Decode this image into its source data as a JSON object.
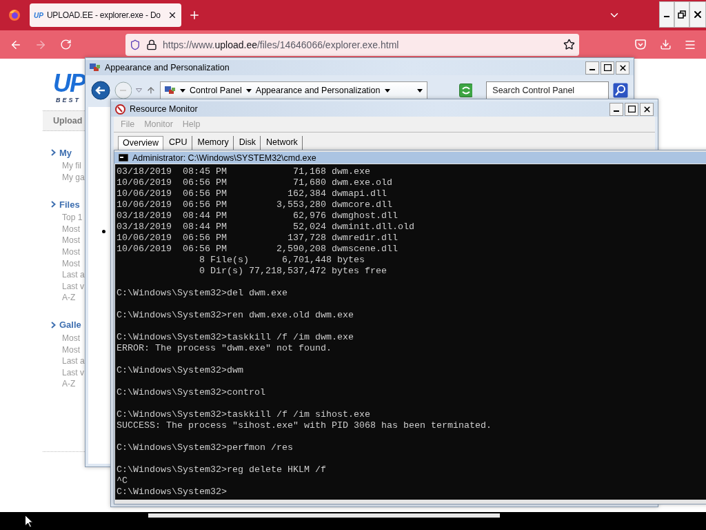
{
  "browser": {
    "tabs": [
      {
        "favicon": "UP",
        "title": "UPLOAD.EE - explorer.exe - Do",
        "selected": true
      }
    ],
    "address": {
      "prefix": "https://www.",
      "domain": "upload.ee",
      "path": "/files/14646066/explorer.exe.html"
    }
  },
  "webpage": {
    "logo": "UP",
    "tagline": "BEST",
    "nav": [
      "Upload"
    ],
    "sections": [
      {
        "title": "My",
        "items": [
          "My fil",
          "My ga"
        ]
      },
      {
        "title": "Files",
        "items": [
          "Top 1",
          "Most",
          "Most",
          "Most",
          "Most",
          "Last a",
          "Last v",
          "A-Z"
        ]
      },
      {
        "title": "Galle",
        "items": [
          "Most",
          "Most",
          "Last a",
          "Last v",
          "A-Z"
        ]
      }
    ]
  },
  "appearance_window": {
    "title": "Appearance and Personalization",
    "breadcrumb": [
      "Control Panel",
      "Appearance and Personalization"
    ],
    "search": {
      "placeholder": "Search Control Panel"
    }
  },
  "resource_monitor": {
    "title": "Resource Monitor",
    "menu": [
      {
        "label": "File",
        "disabled": true
      },
      {
        "label": "Monitor",
        "disabled": true
      },
      {
        "label": "Help",
        "disabled": true
      }
    ],
    "tabs": [
      {
        "label": "Overview",
        "selected": true
      },
      {
        "label": "CPU",
        "selected": false
      },
      {
        "label": "Memory",
        "selected": false
      },
      {
        "label": "Disk",
        "selected": false
      },
      {
        "label": "Network",
        "selected": false
      }
    ]
  },
  "cmd_window": {
    "title": "Administrator: C:\\Windows\\SYSTEM32\\cmd.exe",
    "blocks": [
      [
        "03/18/2019  08:45 PM            71,168 dwm.exe",
        "10/06/2019  06:56 PM            71,680 dwm.exe.old",
        "10/06/2019  06:56 PM           162,384 dwmapi.dll",
        "10/06/2019  06:56 PM         3,553,280 dwmcore.dll",
        "03/18/2019  08:44 PM            62,976 dwmghost.dll",
        "03/18/2019  08:44 PM            52,024 dwminit.dll.old",
        "10/06/2019  06:56 PM           137,728 dwmredir.dll",
        "10/06/2019  06:56 PM         2,590,208 dwmscene.dll",
        "               8 File(s)      6,701,448 bytes",
        "               0 Dir(s) 77,218,537,472 bytes free"
      ],
      [
        "C:\\Windows\\System32>del dwm.exe"
      ],
      [
        "C:\\Windows\\System32>ren dwm.exe.old dwm.exe"
      ],
      [
        "C:\\Windows\\System32>taskkill /f /im dwm.exe",
        "ERROR: The process \"dwm.exe\" not found."
      ],
      [
        "C:\\Windows\\System32>dwm"
      ],
      [
        "C:\\Windows\\System32>control"
      ],
      [
        "C:\\Windows\\System32>taskkill /f /im sihost.exe",
        "SUCCESS: The process \"sihost.exe\" with PID 3068 has been terminated."
      ],
      [
        "C:\\Windows\\System32>perfmon /res"
      ],
      [
        "C:\\Windows\\System32>reg delete HKLM /f",
        "^C",
        "C:\\Windows\\System32>"
      ]
    ]
  }
}
